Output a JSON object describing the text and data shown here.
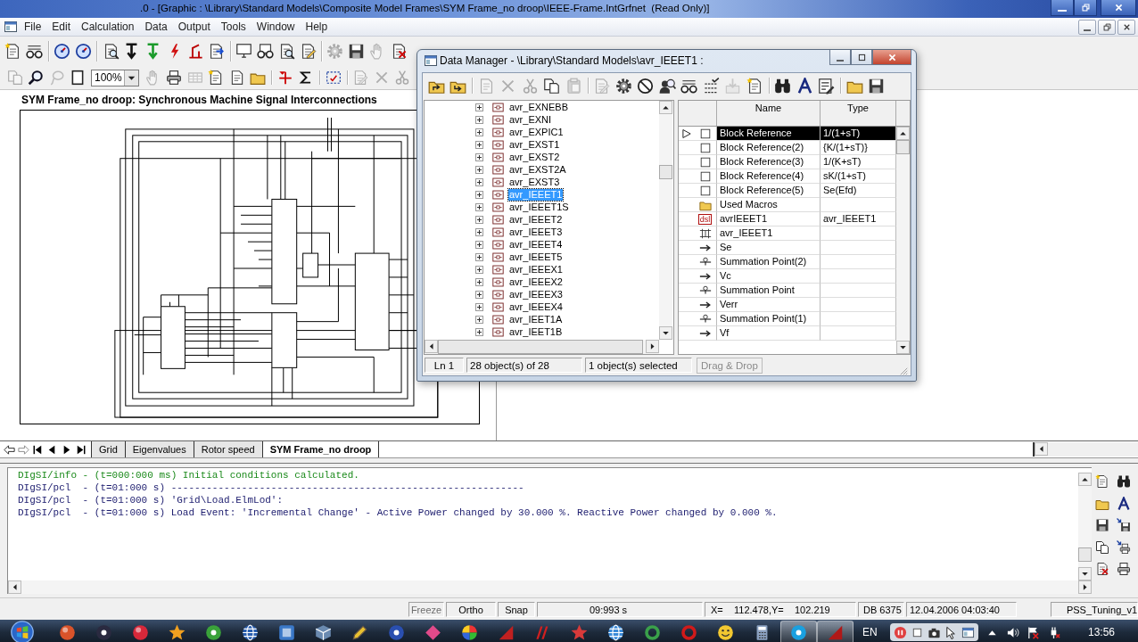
{
  "window": {
    "title": ".0 - [Graphic : \\Library\\Standard Models\\Composite Model Frames\\SYM Frame_no droop\\IEEE-Frame.IntGrfnet  (Read Only)]"
  },
  "menu": [
    "File",
    "Edit",
    "Calculation",
    "Data",
    "Output",
    "Tools",
    "Window",
    "Help"
  ],
  "toolbar_1": {
    "buttons": [
      {
        "disabled": false
      },
      {
        "disabled": false
      },
      {
        "disabled": false
      },
      {
        "disabled": false
      },
      {
        "disabled": false
      },
      {
        "disabled": false
      },
      {
        "disabled": false
      },
      {
        "disabled": false
      },
      {
        "disabled": false
      },
      {
        "disabled": false
      },
      {
        "disabled": false
      },
      {
        "disabled": false
      },
      {
        "disabled": false
      },
      {
        "disabled": false
      },
      {
        "disabled": true
      },
      {
        "disabled": false
      },
      {
        "disabled": true
      },
      {
        "disabled": false
      }
    ]
  },
  "toolbar_2": {
    "zoom": "100%",
    "buttons": [
      {
        "disabled": true
      },
      {
        "disabled": false
      },
      {
        "disabled": true
      },
      {
        "disabled": false
      },
      {
        "disabled": true
      },
      {
        "disabled": false
      },
      {
        "disabled": true
      },
      {
        "disabled": false
      },
      {
        "disabled": false
      },
      {
        "disabled": false
      },
      {
        "disabled": false
      },
      {
        "disabled": false
      },
      {
        "disabled": false
      },
      {
        "disabled": true
      },
      {
        "disabled": true
      },
      {
        "disabled": true
      }
    ]
  },
  "graphic": {
    "heading": "SYM Frame_no droop: Synchronous Machine Signal Interconnections"
  },
  "page_tabs": [
    {
      "label": "Grid",
      "selected": false
    },
    {
      "label": "Eigenvalues",
      "selected": false
    },
    {
      "label": "Rotor speed",
      "selected": false
    },
    {
      "label": "SYM Frame_no droop",
      "selected": true
    }
  ],
  "output": {
    "lines": [
      {
        "kind": "info",
        "text": "DIgSI/info - (t=000:000 ms) Initial conditions calculated."
      },
      {
        "kind": "message",
        "text": "DIgSI/pcl  - (t=01:000 s) ------------------------------------------------------------"
      },
      {
        "kind": "message",
        "text": "DIgSI/pcl  - (t=01:000 s) 'Grid\\Load.ElmLod':"
      },
      {
        "kind": "message",
        "text": "DIgSI/pcl  - (t=01:000 s) Load Event: 'Incremental Change' - Active Power changed by 30.000 %. Reactive Power changed by 0.000 %."
      }
    ]
  },
  "status_bar": [
    {
      "text": "Freeze",
      "disabled": true
    },
    {
      "text": "Ortho",
      "disabled": false
    },
    {
      "text": "Snap",
      "disabled": false
    },
    {
      "text": "09:993 s",
      "disabled": false
    },
    {
      "text": "X=    112.478,Y=    102.219",
      "disabled": false
    },
    {
      "text": "DB 6375",
      "disabled": false
    },
    {
      "text": "12.04.2006 04:03:40",
      "disabled": false
    },
    {
      "text": "PSS_Tuning_v1",
      "disabled": false
    }
  ],
  "data_manager": {
    "title": "Data Manager - \\Library\\Standard Models\\avr_IEEET1 :",
    "toolbar": {
      "buttons": [
        {
          "disabled": false
        },
        {
          "disabled": false
        },
        {
          "disabled": true
        },
        {
          "disabled": true
        },
        {
          "disabled": true
        },
        {
          "disabled": false
        },
        {
          "disabled": true
        },
        {
          "disabled": true
        },
        {
          "disabled": false
        },
        {
          "disabled": false
        },
        {
          "disabled": false
        },
        {
          "disabled": false
        },
        {
          "disabled": false
        },
        {
          "disabled": true
        },
        {
          "disabled": false
        },
        {
          "disabled": false
        },
        {
          "disabled": false
        },
        {
          "disabled": false
        },
        {
          "disabled": false
        },
        {
          "disabled": false
        }
      ]
    },
    "tree": [
      {
        "label": "avr_EXNEBB",
        "expanded": false,
        "selected": false
      },
      {
        "label": "avr_EXNI",
        "expanded": false,
        "selected": false
      },
      {
        "label": "avr_EXPIC1",
        "expanded": false,
        "selected": false
      },
      {
        "label": "avr_EXST1",
        "expanded": false,
        "selected": false
      },
      {
        "label": "avr_EXST2",
        "expanded": false,
        "selected": false
      },
      {
        "label": "avr_EXST2A",
        "expanded": false,
        "selected": false
      },
      {
        "label": "avr_EXST3",
        "expanded": false,
        "selected": false
      },
      {
        "label": "avr_IEEET1",
        "expanded": false,
        "selected": true
      },
      {
        "label": "avr_IEEET1S",
        "expanded": false,
        "selected": false
      },
      {
        "label": "avr_IEEET2",
        "expanded": false,
        "selected": false
      },
      {
        "label": "avr_IEEET3",
        "expanded": false,
        "selected": false
      },
      {
        "label": "avr_IEEET4",
        "expanded": false,
        "selected": false
      },
      {
        "label": "avr_IEEET5",
        "expanded": false,
        "selected": false
      },
      {
        "label": "avr_IEEEX1",
        "expanded": false,
        "selected": false
      },
      {
        "label": "avr_IEEEX2",
        "expanded": false,
        "selected": false
      },
      {
        "label": "avr_IEEEX3",
        "expanded": false,
        "selected": false
      },
      {
        "label": "avr_IEEEX4",
        "expanded": false,
        "selected": false
      },
      {
        "label": "avr_IEET1A",
        "expanded": false,
        "selected": false
      },
      {
        "label": "avr_IEET1B",
        "expanded": false,
        "selected": false
      }
    ],
    "table": {
      "columns": [
        "Name",
        "Type"
      ],
      "rows": [
        {
          "kind": "block",
          "name": "Block Reference",
          "type": "1/(1+sT)",
          "selected": true
        },
        {
          "kind": "block",
          "name": "Block Reference(2)",
          "type": "{K/(1+sT)}",
          "selected": false
        },
        {
          "kind": "block",
          "name": "Block Reference(3)",
          "type": "1/(K+sT)",
          "selected": false
        },
        {
          "kind": "block",
          "name": "Block Reference(4)",
          "type": "sK/(1+sT)",
          "selected": false
        },
        {
          "kind": "block",
          "name": "Block Reference(5)",
          "type": "Se(Efd)",
          "selected": false
        },
        {
          "kind": "folder",
          "name": "Used Macros",
          "selected": false
        },
        {
          "kind": "dsl",
          "tag": "dsl",
          "name": "avrIEEET1",
          "type": "avr_IEEET1",
          "selected": false
        },
        {
          "kind": "equation",
          "name": "avr_IEEET1",
          "selected": false
        },
        {
          "kind": "signal",
          "name": "Se",
          "selected": false
        },
        {
          "kind": "summation",
          "name": "Summation Point(2)",
          "selected": false
        },
        {
          "kind": "signal",
          "name": "Vc",
          "selected": false
        },
        {
          "kind": "summation",
          "name": "Summation Point",
          "selected": false
        },
        {
          "kind": "signal",
          "name": "Verr",
          "selected": false
        },
        {
          "kind": "summation",
          "name": "Summation Point(1)",
          "selected": false
        },
        {
          "kind": "signal",
          "name": "Vf",
          "selected": false
        }
      ]
    },
    "status": [
      "Ln 1",
      "28 object(s) of 28",
      "1 object(s) selected"
    ],
    "drag_drop": {
      "label": "Drag & Drop",
      "disabled": true
    }
  },
  "taskbar": {
    "apps": [
      {
        "active": false
      },
      {
        "active": false
      },
      {
        "active": false
      },
      {
        "active": false
      },
      {
        "active": false
      },
      {
        "active": false
      },
      {
        "active": false
      },
      {
        "active": false
      },
      {
        "active": false
      },
      {
        "active": false
      },
      {
        "active": false
      },
      {
        "active": false
      },
      {
        "active": false
      },
      {
        "active": false
      },
      {
        "active": false
      },
      {
        "active": false
      },
      {
        "active": false
      },
      {
        "active": false
      },
      {
        "active": false
      },
      {
        "active": false
      },
      {
        "active": true
      },
      {
        "active": true
      }
    ],
    "language": "EN",
    "clock": "13:56"
  }
}
